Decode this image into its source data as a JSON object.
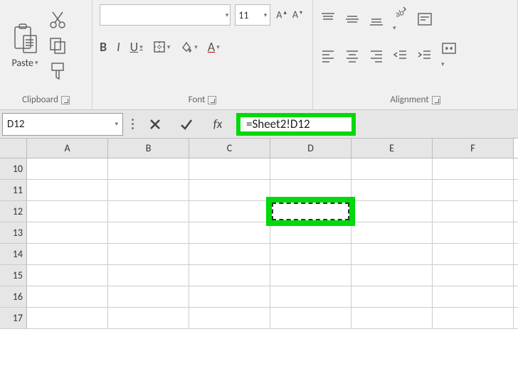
{
  "ribbon": {
    "clipboard": {
      "title": "Clipboard",
      "paste": "Paste"
    },
    "font": {
      "title": "Font",
      "size": "11"
    },
    "alignment": {
      "title": "Alignment"
    }
  },
  "formula_bar": {
    "cell_ref": "D12",
    "fx": "fx",
    "formula": "=Sheet2!D12"
  },
  "grid": {
    "columns": [
      "A",
      "B",
      "C",
      "D",
      "E",
      "F"
    ],
    "rows": [
      "10",
      "11",
      "12",
      "13",
      "14",
      "15",
      "16",
      "17"
    ],
    "active_cell": "D12"
  }
}
